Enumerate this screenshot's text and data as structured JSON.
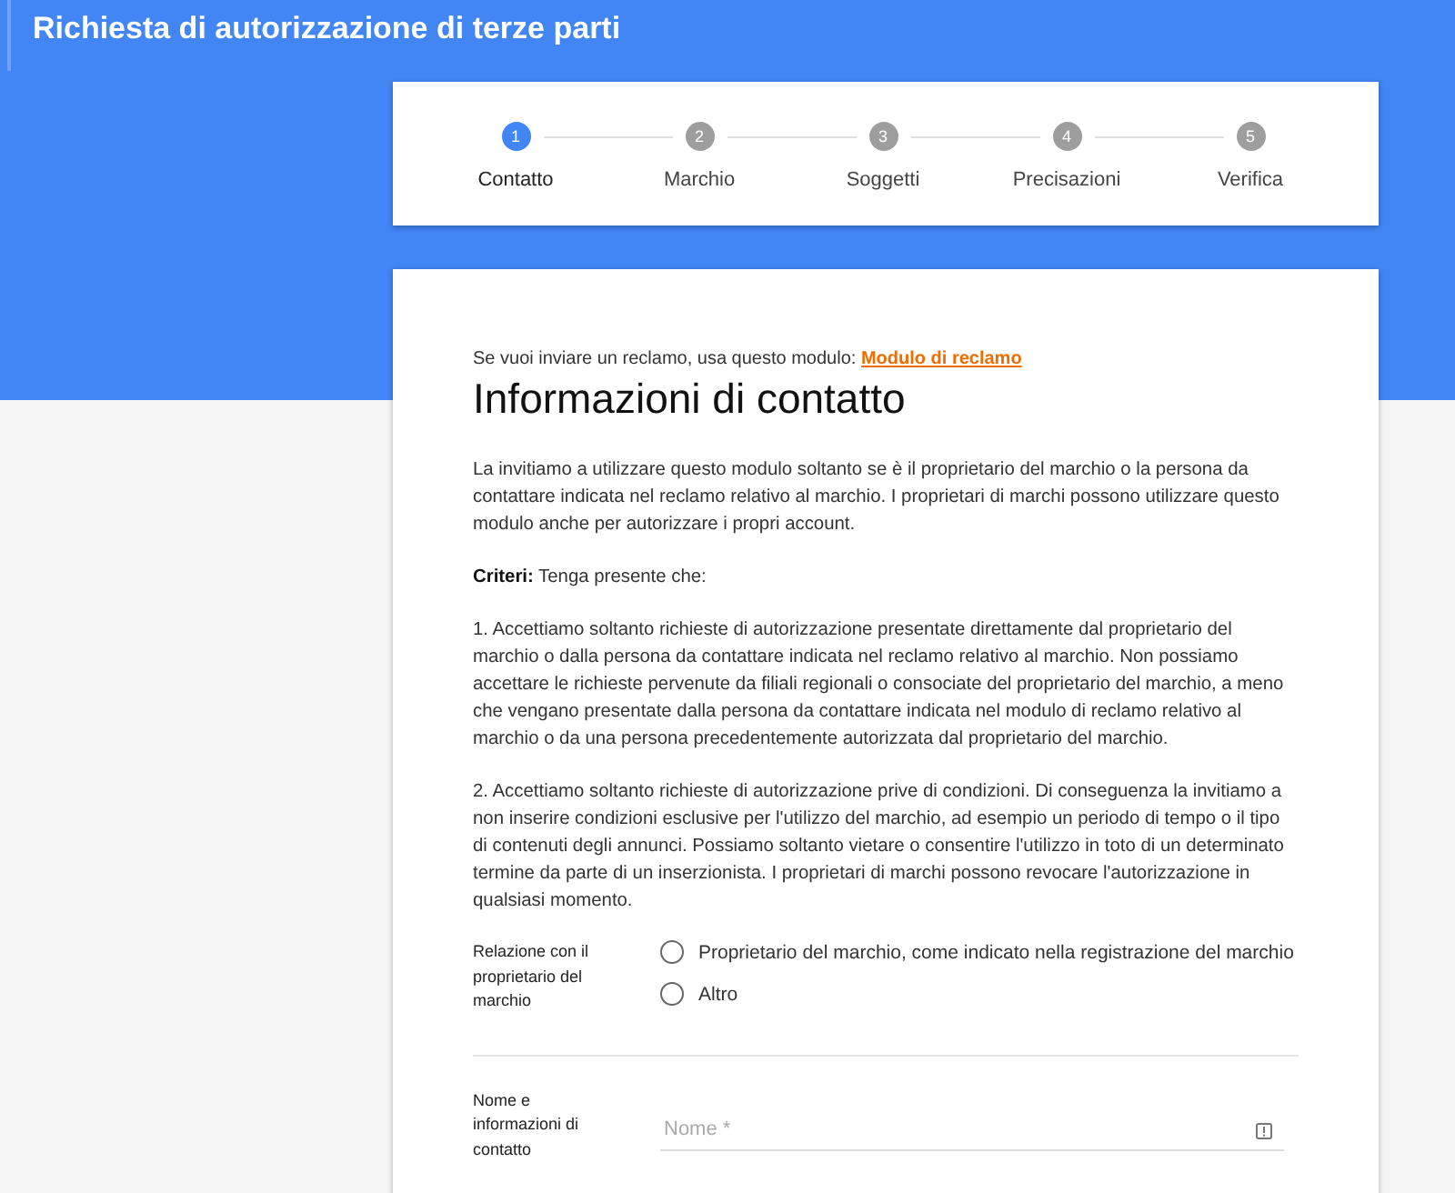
{
  "header": {
    "title": "Richiesta di autorizzazione di terze parti"
  },
  "steps": [
    {
      "number": "1",
      "label": "Contatto",
      "selected": true
    },
    {
      "number": "2",
      "label": "Marchio",
      "selected": false
    },
    {
      "number": "3",
      "label": "Soggetti",
      "selected": false
    },
    {
      "number": "4",
      "label": "Precisazioni",
      "selected": false
    },
    {
      "number": "5",
      "label": "Verifica",
      "selected": false
    }
  ],
  "complaint_note": {
    "text": "Se vuoi inviare un reclamo, usa questo modulo:",
    "link": "Modulo di reclamo"
  },
  "heading": "Informazioni di contatto",
  "paragraphs": [
    "La invitiamo a utilizzare questo modulo soltanto se è il proprietario del marchio o la persona da contattare indicata nel reclamo relativo al marchio. I proprietari di marchi possono utilizzare questo modulo anche per autorizzare i propri account.",
    "**Criteri:** Tenga presente che:",
    "1. Accettiamo soltanto richieste di autorizzazione presentate direttamente dal proprietario del marchio o dalla persona da contattare indicata nel reclamo relativo al marchio. Non possiamo accettare le richieste pervenute da filiali regionali o consociate del proprietario del marchio, a meno che vengano presentate dalla persona da contattare indicata nel modulo di reclamo relativo al marchio o da una persona precedentemente autorizzata dal proprietario del marchio.",
    "2. Accettiamo soltanto richieste di autorizzazione prive di condizioni. Di conseguenza la invitiamo a non inserire condizioni esclusive per l'utilizzo del marchio, ad esempio un periodo di tempo o il tipo di contenuti degli annunci. Possiamo soltanto vietare o consentire l'utilizzo in toto di un determinato termine da parte di un inserzionista. I proprietari di marchi possono revocare l'autorizzazione in qualsiasi momento."
  ],
  "relation": {
    "label": "Relazione con il proprietario del marchio",
    "options": [
      {
        "label": "Proprietario del marchio, come indicato nella registrazione del marchio",
        "selected": false
      },
      {
        "label": "Altro",
        "selected": false
      }
    ]
  },
  "contact": {
    "label": "Nome e informazioni di contatto",
    "name_field": {
      "placeholder": "Nome *"
    }
  }
}
